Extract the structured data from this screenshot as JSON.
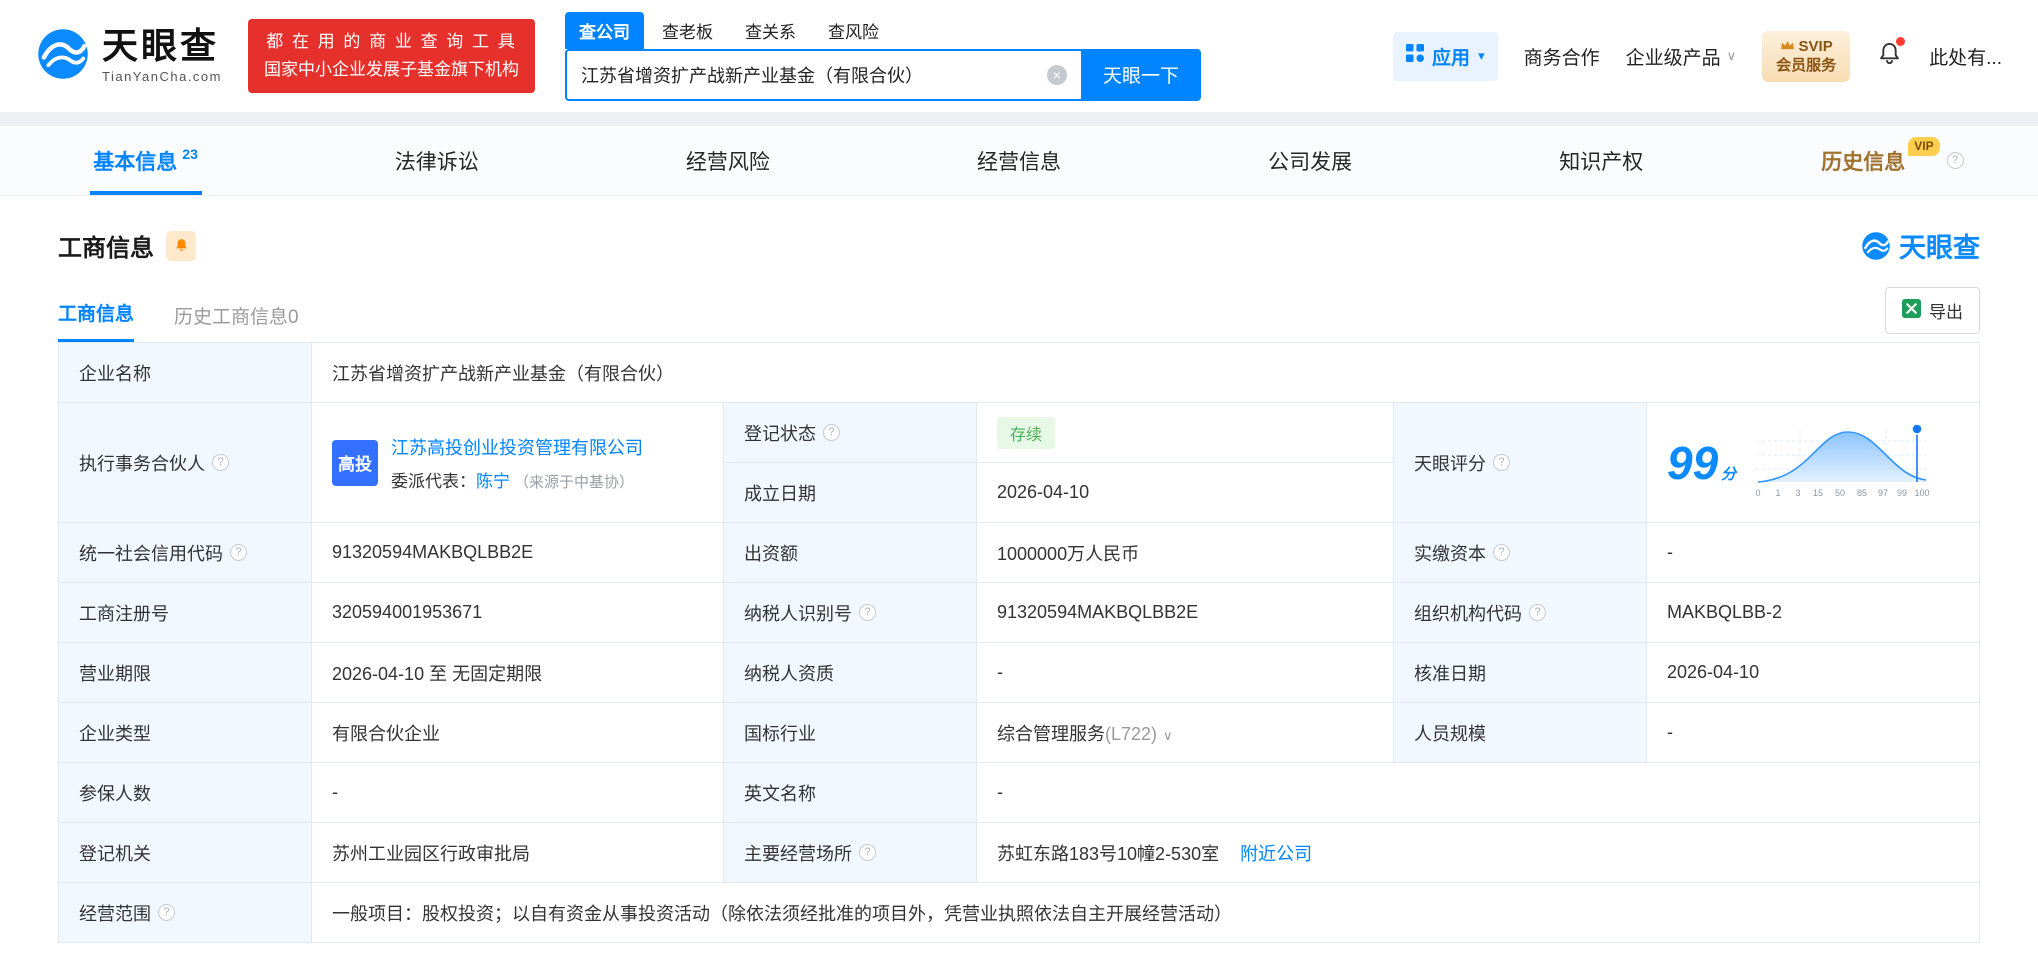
{
  "brand": {
    "name": "天眼查",
    "domain": "TianYanCha.com"
  },
  "promo": {
    "line1": "都 在 用 的 商 业 查 询 工 具",
    "line2": "国家中小企业发展子基金旗下机构"
  },
  "search": {
    "tabs": [
      "查公司",
      "查老板",
      "查关系",
      "查风险"
    ],
    "value": "江苏省增资扩产战新产业基金（有限合伙）",
    "button": "天眼一下"
  },
  "headerRight": {
    "apps": "应用",
    "cooperation": "商务合作",
    "enterprise": "企业级产品",
    "svipTop": "SVIP",
    "svipBottom": "会员服务",
    "user": "此处有..."
  },
  "mainTabs": {
    "basic": "基本信息",
    "basicCount": "23",
    "legal": "法律诉讼",
    "risk": "经营风险",
    "operation": "经营信息",
    "development": "公司发展",
    "ip": "知识产权",
    "history": "历史信息",
    "historyVip": "VIP"
  },
  "section": {
    "title": "工商信息",
    "watermark": "天眼查",
    "subtabActive": "工商信息",
    "subtabHistory": "历史工商信息0",
    "export": "导出"
  },
  "biz": {
    "name": {
      "label": "企业名称",
      "value": "江苏省增资扩产战新产业基金（有限合伙）"
    },
    "partner": {
      "label": "执行事务合伙人",
      "logo": "高投",
      "company": "江苏高投创业投资管理有限公司",
      "delegateLabel": "委派代表：",
      "delegate": "陈宁",
      "source": "（来源于中基协）"
    },
    "status": {
      "label": "登记状态",
      "value": "存续"
    },
    "established": {
      "label": "成立日期",
      "value": "2026-04-10"
    },
    "score": {
      "label": "天眼评分",
      "value": "99",
      "unit": "分",
      "axis": [
        "0",
        "1",
        "3",
        "15",
        "50",
        "85",
        "97",
        "99",
        "100"
      ]
    },
    "creditCode": {
      "label": "统一社会信用代码",
      "value": "91320594MAKBQLBB2E"
    },
    "capital": {
      "label": "出资额",
      "value": "1000000万人民币"
    },
    "paidCapital": {
      "label": "实缴资本",
      "value": "-"
    },
    "regNumber": {
      "label": "工商注册号",
      "value": "320594001953671"
    },
    "taxpayerId": {
      "label": "纳税人识别号",
      "value": "91320594MAKBQLBB2E"
    },
    "orgCode": {
      "label": "组织机构代码",
      "value": "MAKBQLBB-2"
    },
    "term": {
      "label": "营业期限",
      "value": "2026-04-10 至 无固定期限"
    },
    "taxQualification": {
      "label": "纳税人资质",
      "value": "-"
    },
    "approvalDate": {
      "label": "核准日期",
      "value": "2026-04-10"
    },
    "companyType": {
      "label": "企业类型",
      "value": "有限合伙企业"
    },
    "industry": {
      "label": "国标行业",
      "value": "综合管理服务",
      "code": "(L722)"
    },
    "staffSize": {
      "label": "人员规模",
      "value": "-"
    },
    "insuredCount": {
      "label": "参保人数",
      "value": "-"
    },
    "englishName": {
      "label": "英文名称",
      "value": "-"
    },
    "authority": {
      "label": "登记机关",
      "value": "苏州工业园区行政审批局"
    },
    "address": {
      "label": "主要经营场所",
      "value": "苏虹东路183号10幢2-530室",
      "link": "附近公司"
    },
    "scope": {
      "label": "经营范围",
      "value": "一般项目：股权投资；以自有资金从事投资活动（除依法须经批准的项目外，凭营业执照依法自主开展经营活动）"
    }
  },
  "icons": {
    "help": "?",
    "caretDown": "▾",
    "chevronDown": "∨",
    "clear": "×"
  }
}
